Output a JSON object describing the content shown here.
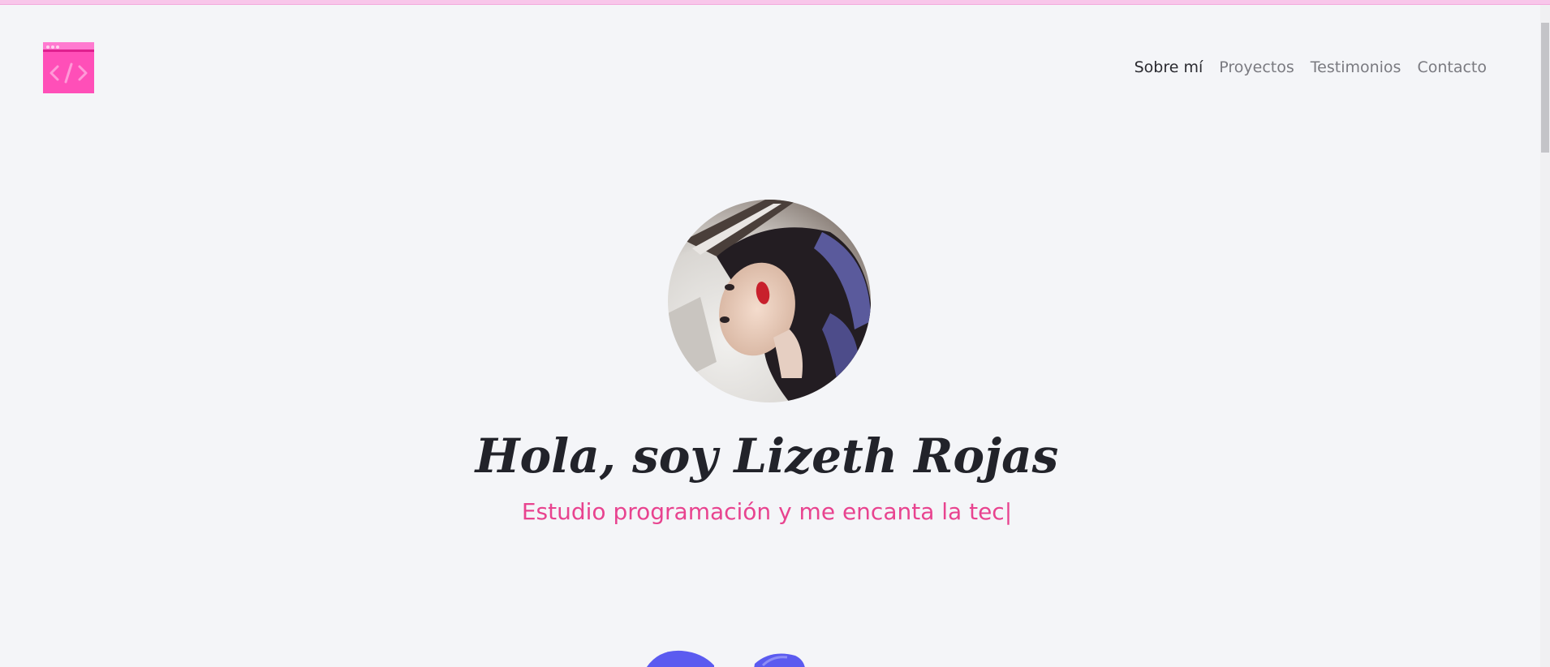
{
  "header": {
    "logo": {
      "icon": "code-window-icon",
      "symbol": "</>"
    },
    "nav": [
      {
        "label": "Sobre mí",
        "active": true
      },
      {
        "label": "Proyectos",
        "active": false
      },
      {
        "label": "Testimonios",
        "active": false
      },
      {
        "label": "Contacto",
        "active": false
      }
    ]
  },
  "hero": {
    "avatar_alt": "profile-photo",
    "title": "Hola, soy Lizeth Rojas",
    "subtitle": "Estudio programación y me encanta la tec",
    "cursor": "|"
  },
  "colors": {
    "background": "#f4f5f8",
    "accent_pink": "#e8438f",
    "logo_pink": "#ff4fb8",
    "title_dark": "#22232a",
    "blob_blue": "#5b5bf0"
  }
}
